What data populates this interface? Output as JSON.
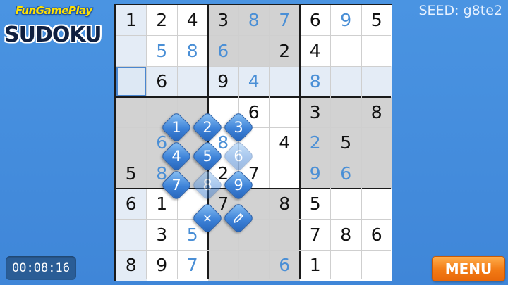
{
  "logo": {
    "top": "FunGamePlay",
    "main": "SUDOKU"
  },
  "seed": "SEED: g8te2",
  "timer": "00:08:16",
  "menu_label": "MENU",
  "board": {
    "rows": [
      [
        {
          "v": "1",
          "u": false
        },
        {
          "v": "2",
          "u": false
        },
        {
          "v": "4",
          "u": false
        },
        {
          "v": "3",
          "u": false
        },
        {
          "v": "8",
          "u": true
        },
        {
          "v": "7",
          "u": true
        },
        {
          "v": "6",
          "u": false
        },
        {
          "v": "9",
          "u": true
        },
        {
          "v": "5",
          "u": false
        }
      ],
      [
        {
          "v": "",
          "u": false
        },
        {
          "v": "5",
          "u": true
        },
        {
          "v": "8",
          "u": true
        },
        {
          "v": "6",
          "u": true
        },
        {
          "v": "",
          "u": false
        },
        {
          "v": "2",
          "u": false
        },
        {
          "v": "4",
          "u": false
        },
        {
          "v": "",
          "u": false
        },
        {
          "v": "",
          "u": false
        }
      ],
      [
        {
          "v": "",
          "u": false
        },
        {
          "v": "6",
          "u": false
        },
        {
          "v": "",
          "u": false
        },
        {
          "v": "9",
          "u": false
        },
        {
          "v": "4",
          "u": true
        },
        {
          "v": "",
          "u": false
        },
        {
          "v": "8",
          "u": true
        },
        {
          "v": "",
          "u": false
        },
        {
          "v": "",
          "u": false
        }
      ],
      [
        {
          "v": "",
          "u": false
        },
        {
          "v": "",
          "u": false
        },
        {
          "v": "",
          "u": false
        },
        {
          "v": "",
          "u": false
        },
        {
          "v": "6",
          "u": false
        },
        {
          "v": "",
          "u": false
        },
        {
          "v": "3",
          "u": false
        },
        {
          "v": "",
          "u": false
        },
        {
          "v": "8",
          "u": false
        }
      ],
      [
        {
          "v": "",
          "u": false
        },
        {
          "v": "6",
          "u": true
        },
        {
          "v": "",
          "u": false
        },
        {
          "v": "8",
          "u": true
        },
        {
          "v": "",
          "u": false
        },
        {
          "v": "4",
          "u": false
        },
        {
          "v": "2",
          "u": true
        },
        {
          "v": "5",
          "u": false
        },
        {
          "v": "",
          "u": false
        }
      ],
      [
        {
          "v": "5",
          "u": false
        },
        {
          "v": "8",
          "u": true
        },
        {
          "v": "",
          "u": false
        },
        {
          "v": "2",
          "u": false
        },
        {
          "v": "7",
          "u": false
        },
        {
          "v": "",
          "u": false
        },
        {
          "v": "9",
          "u": true
        },
        {
          "v": "6",
          "u": true
        },
        {
          "v": "",
          "u": false
        }
      ],
      [
        {
          "v": "6",
          "u": false
        },
        {
          "v": "1",
          "u": false
        },
        {
          "v": "",
          "u": false
        },
        {
          "v": "7",
          "u": false
        },
        {
          "v": "",
          "u": false
        },
        {
          "v": "8",
          "u": false
        },
        {
          "v": "5",
          "u": false
        },
        {
          "v": "",
          "u": false
        },
        {
          "v": "",
          "u": false
        }
      ],
      [
        {
          "v": "",
          "u": false
        },
        {
          "v": "3",
          "u": false
        },
        {
          "v": "5",
          "u": true
        },
        {
          "v": "",
          "u": false
        },
        {
          "v": "",
          "u": false
        },
        {
          "v": "",
          "u": false
        },
        {
          "v": "7",
          "u": false
        },
        {
          "v": "8",
          "u": false
        },
        {
          "v": "6",
          "u": false
        }
      ],
      [
        {
          "v": "8",
          "u": false
        },
        {
          "v": "9",
          "u": false
        },
        {
          "v": "7",
          "u": true
        },
        {
          "v": "",
          "u": false
        },
        {
          "v": "",
          "u": false
        },
        {
          "v": "6",
          "u": true
        },
        {
          "v": "1",
          "u": false
        },
        {
          "v": "",
          "u": false
        },
        {
          "v": "",
          "u": false
        }
      ]
    ],
    "selected": [
      2,
      0
    ]
  },
  "picker": {
    "buttons": [
      {
        "label": "1",
        "faded": false
      },
      {
        "label": "2",
        "faded": false
      },
      {
        "label": "3",
        "faded": false
      },
      {
        "label": "4",
        "faded": false
      },
      {
        "label": "5",
        "faded": false
      },
      {
        "label": "6",
        "faded": true
      },
      {
        "label": "7",
        "faded": false
      },
      {
        "label": "8",
        "faded": true
      },
      {
        "label": "9",
        "faded": false
      }
    ],
    "clear_icon": "close-icon",
    "pencil_icon": "pencil-icon"
  },
  "colors": {
    "background": "#4a94e2",
    "given_digit": "#111111",
    "user_digit": "#4a8fd6",
    "highlight_gray": "#d2d2d2",
    "highlight_light": "#e4ecf6",
    "menu_orange": "#f27a14",
    "picker_blue": "#3d82d8"
  }
}
